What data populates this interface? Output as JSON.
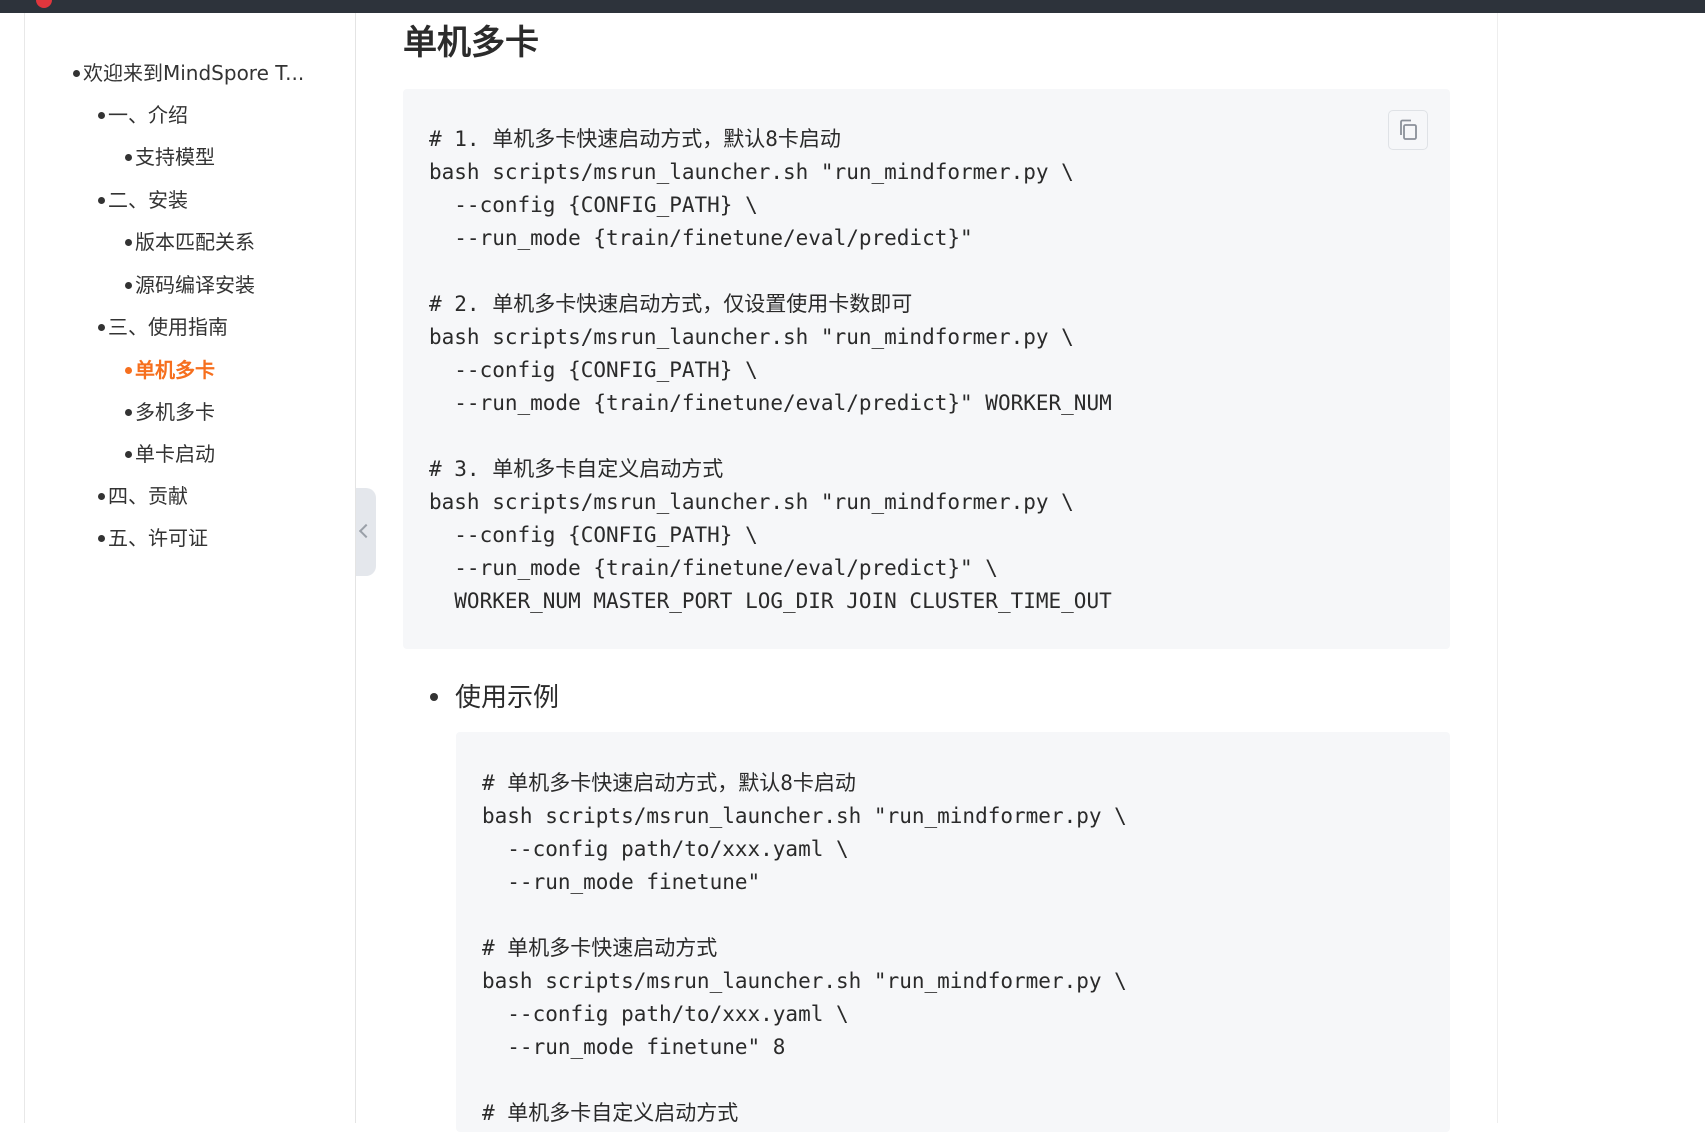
{
  "toc": {
    "items": [
      {
        "label": "欢迎来到MindSpore T...",
        "level": 1,
        "active": false
      },
      {
        "label": "一、介绍",
        "level": 2,
        "active": false
      },
      {
        "label": "支持模型",
        "level": 3,
        "active": false
      },
      {
        "label": "二、安装",
        "level": 2,
        "active": false
      },
      {
        "label": "版本匹配关系",
        "level": 3,
        "active": false
      },
      {
        "label": "源码编译安装",
        "level": 3,
        "active": false
      },
      {
        "label": "三、使用指南",
        "level": 2,
        "active": false
      },
      {
        "label": "单机多卡",
        "level": 3,
        "active": true
      },
      {
        "label": "多机多卡",
        "level": 3,
        "active": false
      },
      {
        "label": "单卡启动",
        "level": 3,
        "active": false
      },
      {
        "label": "四、贡献",
        "level": 2,
        "active": false
      },
      {
        "label": "五、许可证",
        "level": 2,
        "active": false
      }
    ],
    "active_color": "#f66f1e"
  },
  "main": {
    "heading": "单机多卡",
    "code1": {
      "lines": [
        "# 1. 单机多卡快速启动方式，默认8卡启动",
        "bash scripts/msrun_launcher.sh \"run_mindformer.py \\",
        "  --config {CONFIG_PATH} \\",
        "  --run_mode {train/finetune/eval/predict}\"",
        "",
        "# 2. 单机多卡快速启动方式，仅设置使用卡数即可",
        "bash scripts/msrun_launcher.sh \"run_mindformer.py \\",
        "  --config {CONFIG_PATH} \\",
        "  --run_mode {train/finetune/eval/predict}\" WORKER_NUM",
        "",
        "# 3. 单机多卡自定义启动方式",
        "bash scripts/msrun_launcher.sh \"run_mindformer.py \\",
        "  --config {CONFIG_PATH} \\",
        "  --run_mode {train/finetune/eval/predict}\" \\",
        "  WORKER_NUM MASTER_PORT LOG_DIR JOIN CLUSTER_TIME_OUT"
      ],
      "copy_icon": "copy-icon"
    },
    "sub_heading": "使用示例",
    "code2": {
      "lines": [
        "# 单机多卡快速启动方式，默认8卡启动",
        "bash scripts/msrun_launcher.sh \"run_mindformer.py \\",
        "  --config path/to/xxx.yaml \\",
        "  --run_mode finetune\"",
        "",
        "# 单机多卡快速启动方式",
        "bash scripts/msrun_launcher.sh \"run_mindformer.py \\",
        "  --config path/to/xxx.yaml \\",
        "  --run_mode finetune\" 8",
        "",
        "# 单机多卡自定义启动方式"
      ]
    }
  }
}
